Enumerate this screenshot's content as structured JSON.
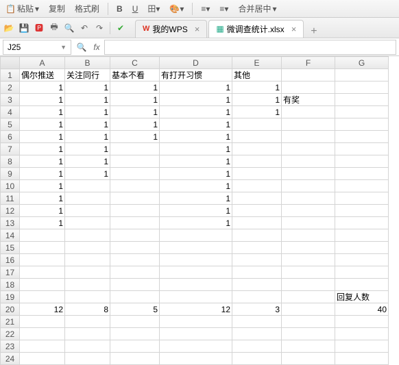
{
  "toolbar_top": {
    "paste_label": "粘贴",
    "copy_label": "复制",
    "format_painter_label": "格式刷",
    "merge_label": "合并居中"
  },
  "tabs": {
    "wps_label": "我的WPS",
    "file_label": "微调查统计.xlsx"
  },
  "namebox": {
    "value": "J25"
  },
  "fx_label": "fx",
  "columns": [
    "A",
    "B",
    "C",
    "D",
    "E",
    "F",
    "G"
  ],
  "row_count": 24,
  "headers": {
    "A": "偶尔推送",
    "B": "关注同行",
    "C": "基本不看",
    "D": "有打开习惯",
    "E": "其他"
  },
  "cells": {
    "2": {
      "A": "1",
      "B": "1",
      "C": "1",
      "D": "1",
      "E": "1"
    },
    "3": {
      "A": "1",
      "B": "1",
      "C": "1",
      "D": "1",
      "E": "1",
      "F": "有奖"
    },
    "4": {
      "A": "1",
      "B": "1",
      "C": "1",
      "D": "1",
      "E": "1"
    },
    "5": {
      "A": "1",
      "B": "1",
      "C": "1",
      "D": "1"
    },
    "6": {
      "A": "1",
      "B": "1",
      "C": "1",
      "D": "1"
    },
    "7": {
      "A": "1",
      "B": "1",
      "D": "1"
    },
    "8": {
      "A": "1",
      "B": "1",
      "D": "1"
    },
    "9": {
      "A": "1",
      "B": "1",
      "D": "1"
    },
    "10": {
      "A": "1",
      "D": "1"
    },
    "11": {
      "A": "1",
      "D": "1"
    },
    "12": {
      "A": "1",
      "D": "1"
    },
    "13": {
      "A": "1",
      "D": "1"
    },
    "19": {
      "G": "回复人数"
    },
    "20": {
      "A": "12",
      "B": "8",
      "C": "5",
      "D": "12",
      "E": "3",
      "G": "40"
    }
  },
  "text_cells": [
    "3F",
    "19G"
  ],
  "chart_data": {
    "type": "table",
    "title": "微调查统计",
    "columns": [
      "偶尔推送",
      "关注同行",
      "基本不看",
      "有打开习惯",
      "其他"
    ],
    "totals": {
      "偶尔推送": 12,
      "关注同行": 8,
      "基本不看": 5,
      "有打开习惯": 12,
      "其他": 3
    },
    "回复人数": 40,
    "note": "有奖"
  }
}
